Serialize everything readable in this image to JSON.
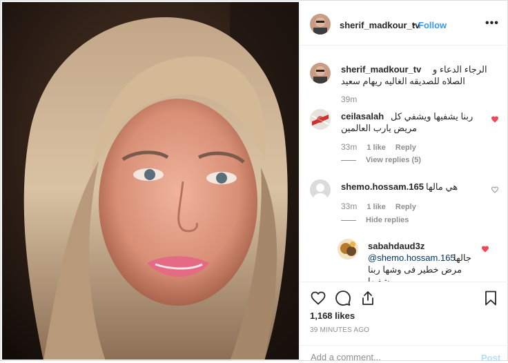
{
  "post": {
    "username": "sherif_madkour_tv",
    "separator": "•",
    "follow_label": "Follow",
    "more_label": "•••"
  },
  "comments": [
    {
      "username": "sherif_madkour_tv",
      "text_line1": "الرجاء الدعاء و",
      "text_line2": "الصلاه للصديقه الغاليه ريهام سعيد",
      "time": "39m"
    },
    {
      "username": "ceilasalah",
      "text_line1": "ربنا يشفيها ويشفي كل",
      "text_line2": "مريض يارب العالمين",
      "time": "33m",
      "likes": "1 like",
      "reply": "Reply",
      "replies_toggle": "View replies (5)",
      "liked": true
    },
    {
      "username": "shemo.hossam.165",
      "text_line1": "هي مالها",
      "time": "33m",
      "likes": "1 like",
      "reply": "Reply",
      "replies_toggle": "Hide replies",
      "liked": false
    },
    {
      "username": "sabahdaud3z",
      "mention": "@shemo.hossam.165",
      "text_line1": "جالها",
      "text_line2": "مرض خطير فى وشها ربنا",
      "text_line3": "يشفيها",
      "liked": true
    }
  ],
  "stats": {
    "likes": "1,168 likes",
    "posted": "39 MINUTES AGO"
  },
  "add_comment": {
    "placeholder": "Add a comment...",
    "post_label": "Post"
  },
  "colors": {
    "accent": "#3897f0",
    "heart": "#ed4956",
    "muted": "#8e8e8e",
    "post_disabled": "#b2dffc"
  },
  "icons": [
    "heart-icon",
    "comment-icon",
    "share-icon",
    "bookmark-icon",
    "more-icon"
  ]
}
